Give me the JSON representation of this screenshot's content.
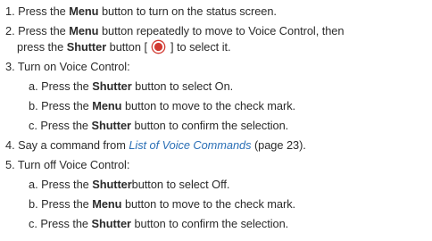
{
  "instructions": {
    "s1": {
      "num": "1.",
      "a": "Press the ",
      "b": "Menu",
      "c": " button to turn on the status screen."
    },
    "s2": {
      "num": "2.",
      "a": "Press the ",
      "b": "Menu",
      "c": " button repeatedly to move to Voice Control, then",
      "d": "press the ",
      "e": "Shutter",
      "f": " button [ ",
      "g": " ] to select it."
    },
    "s3": {
      "num": "3.",
      "text": "Turn on Voice Control:",
      "a": {
        "letter": "a.",
        "p1": "Press the ",
        "p2": "Shutter",
        "p3": " button to select On."
      },
      "b": {
        "letter": "b.",
        "p1": "Press the ",
        "p2": "Menu",
        "p3": "  button to move to the check mark."
      },
      "c": {
        "letter": "c.",
        "p1": "Press the ",
        "p2": "Shutter",
        "p3": " button to confirm the selection."
      }
    },
    "s4": {
      "num": "4.",
      "a": "Say a command from ",
      "link": "List of Voice Commands",
      "c": " (page 23)."
    },
    "s5": {
      "num": "5.",
      "text": "Turn off Voice Control:",
      "a": {
        "letter": "a.",
        "p1": "Press the ",
        "p2": "Shutter",
        "p3": "button to select Off."
      },
      "b": {
        "letter": "b.",
        "p1": "Press the ",
        "p2": "Menu",
        "p3": "  button to move to the check mark."
      },
      "c": {
        "letter": "c.",
        "p1": "Press the ",
        "p2": "Shutter",
        "p3": " button to confirm the selection."
      }
    }
  },
  "icons": {
    "shutter": "shutter-button-icon"
  },
  "colors": {
    "text": "#2b2b2b",
    "link": "#2a6fb6",
    "icon": "#d23a32"
  }
}
